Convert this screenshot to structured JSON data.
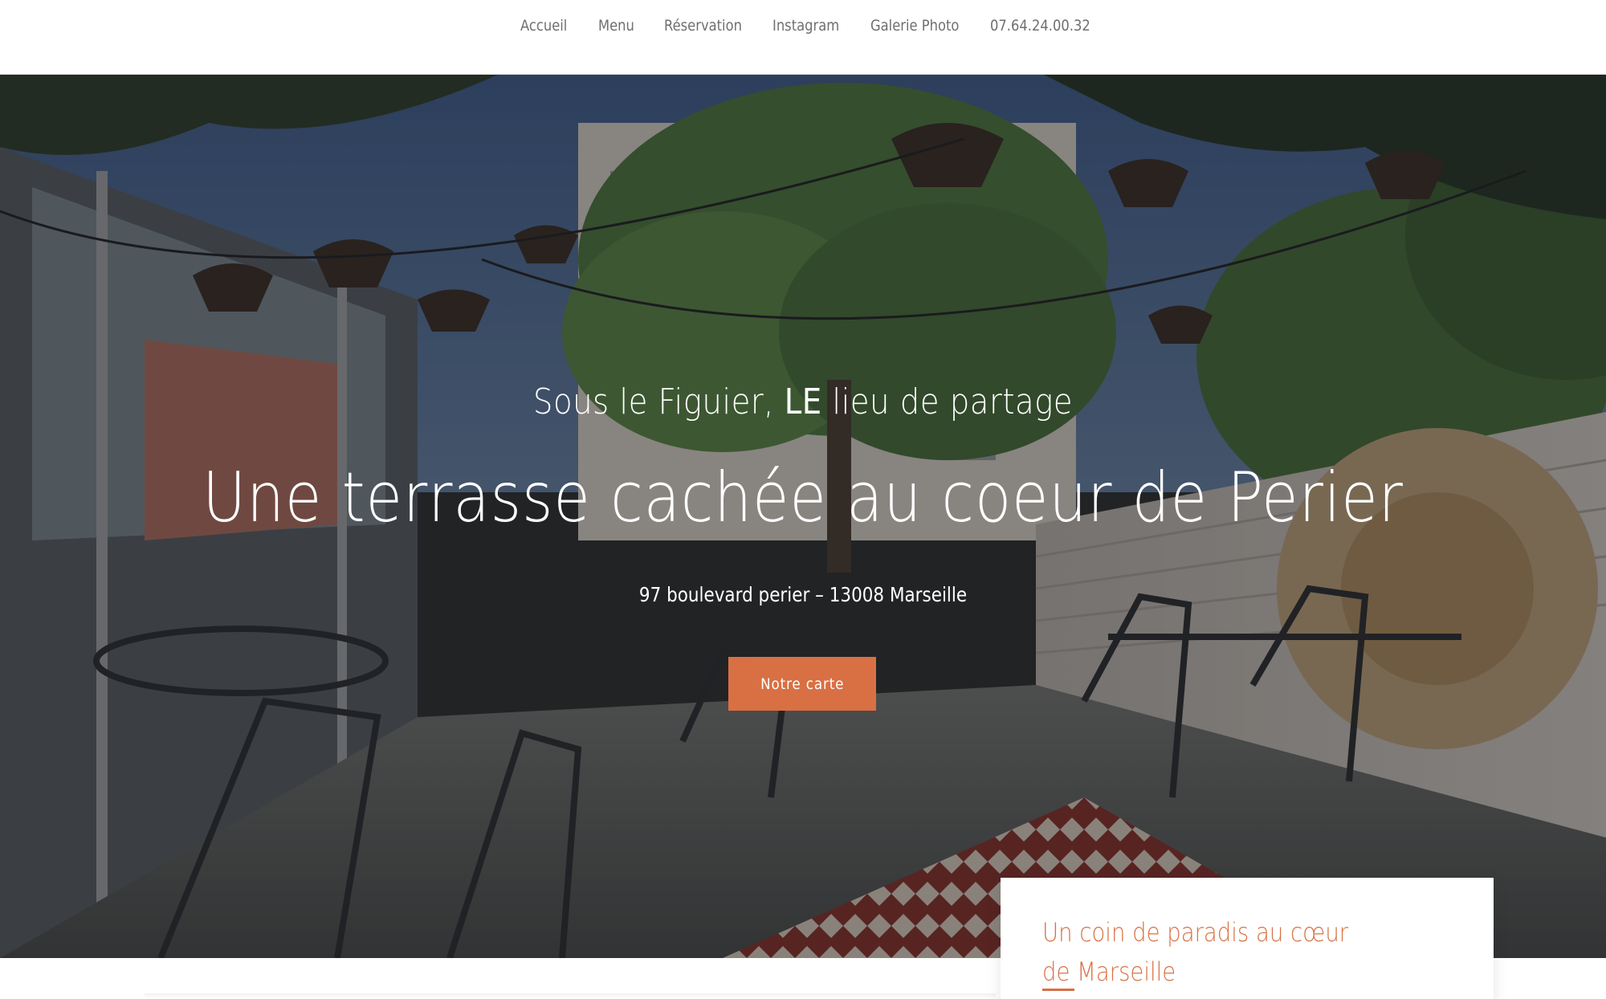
{
  "nav": {
    "items": [
      {
        "label": "Accueil"
      },
      {
        "label": "Menu"
      },
      {
        "label": "Réservation"
      },
      {
        "label": "Instagram"
      },
      {
        "label": "Galerie Photo"
      },
      {
        "label": "07.64.24.00.32"
      }
    ]
  },
  "hero": {
    "eyebrow_pre": "Sous le Figuier, ",
    "eyebrow_strong": "LE",
    "eyebrow_post": " lieu de partage",
    "title": "Une terrasse cachée au coeur de Perier",
    "address": "97 boulevard perier – 13008 Marseille",
    "cta_label": "Notre carte"
  },
  "card": {
    "title": "Un coin de paradis au cœur de Marseille"
  },
  "colors": {
    "accent": "#d87044",
    "nav_text": "#6f6f6f",
    "hero_text": "#ffffff"
  }
}
